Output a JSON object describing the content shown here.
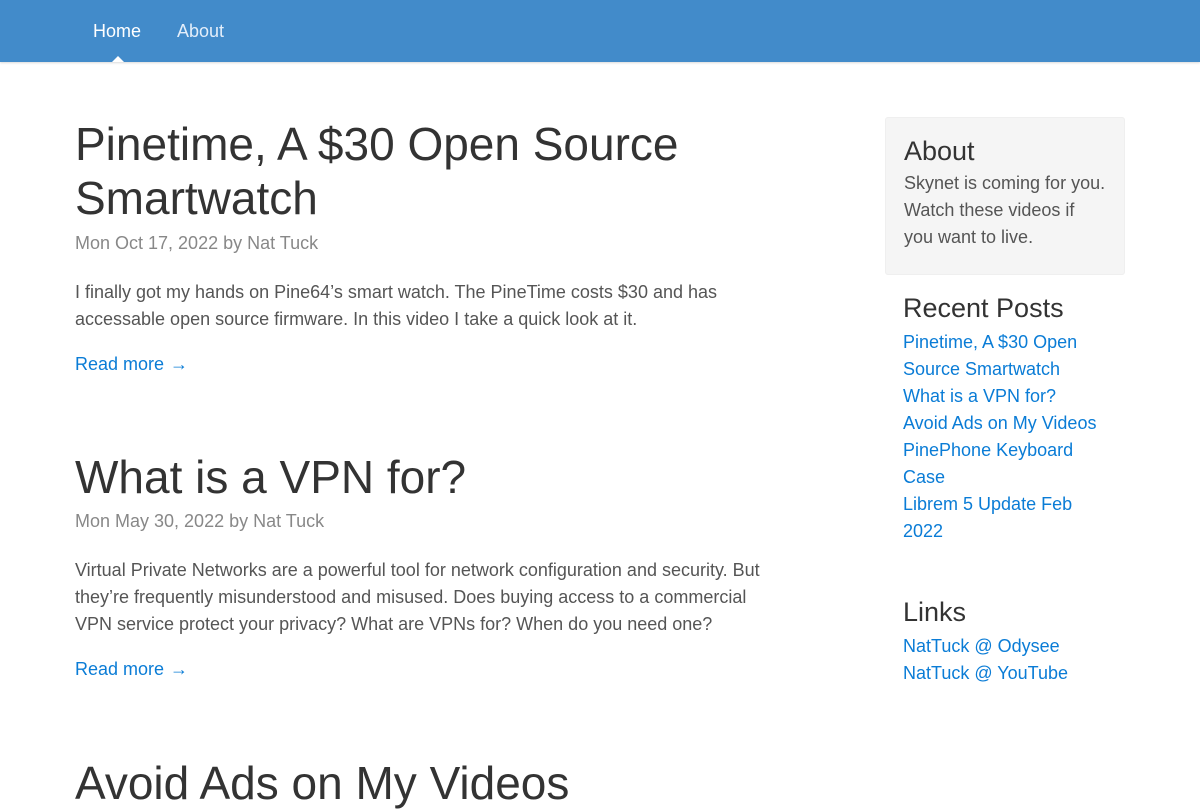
{
  "nav": {
    "items": [
      {
        "label": "Home"
      },
      {
        "label": "About"
      }
    ]
  },
  "posts": [
    {
      "title": "Pinetime, A $30 Open Source Smartwatch",
      "meta": "Mon Oct 17, 2022 by Nat Tuck",
      "excerpt": "I finally got my hands on Pine64’s smart watch. The PineTime costs $30 and has accessable open source firmware. In this video I take a quick look at it.",
      "read_more": "Read more",
      "arrow": "→"
    },
    {
      "title": "What is a VPN for?",
      "meta": "Mon May 30, 2022 by Nat Tuck",
      "excerpt": "Virtual Private Networks are a powerful tool for network configuration and security. But they’re frequently misunderstood and misused. Does buying access to a commercial VPN service protect your privacy? What are VPNs for? When do you need one?",
      "read_more": "Read more",
      "arrow": "→"
    },
    {
      "title": "Avoid Ads on My Videos"
    }
  ],
  "sidebar": {
    "about": {
      "title": "About",
      "text": "Skynet is coming for you. Watch these videos if you want to live."
    },
    "recent": {
      "title": "Recent Posts",
      "items": [
        {
          "label": "Pinetime, A $30 Open Source Smartwatch"
        },
        {
          "label": "What is a VPN for?"
        },
        {
          "label": "Avoid Ads on My Videos"
        },
        {
          "label": "PinePhone Keyboard Case"
        },
        {
          "label": "Librem 5 Update Feb 2022"
        }
      ]
    },
    "links": {
      "title": "Links",
      "items": [
        {
          "label": "NatTuck @ Odysee"
        },
        {
          "label": "NatTuck @ YouTube"
        }
      ]
    }
  },
  "colors": {
    "navbar": "#428bca",
    "link": "#0a7cd6",
    "sidebar_box": "#f5f5f5"
  }
}
